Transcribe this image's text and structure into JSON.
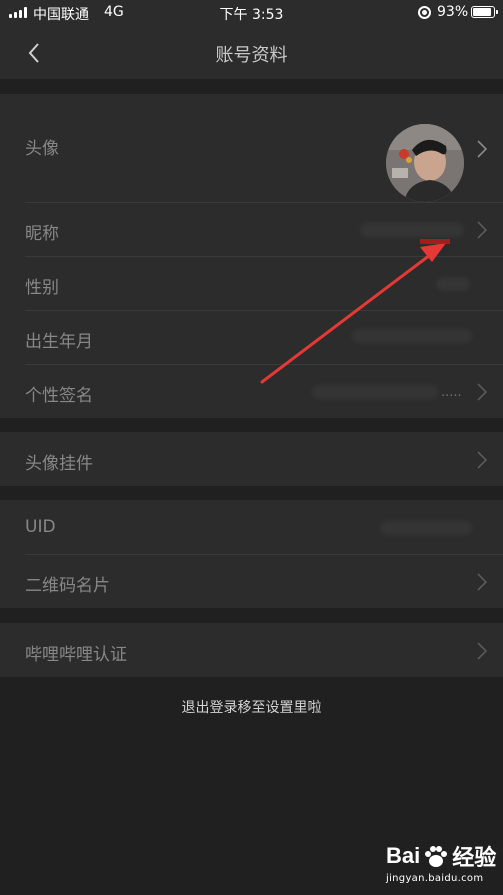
{
  "status_bar": {
    "carrier": "中国联通",
    "network": "4G",
    "time": "下午 3:53",
    "battery_percent": "93%",
    "battery_level": 0.93
  },
  "nav": {
    "title": "账号资料",
    "back_icon": "chevron-left-icon"
  },
  "profile_group": {
    "avatar_label": "头像",
    "nickname_label": "昵称",
    "gender_label": "性别",
    "birth_label": "出生年月",
    "signature_label": "个性签名",
    "signature_ellipsis": "....."
  },
  "pendant_group": {
    "pendant_label": "头像挂件"
  },
  "id_group": {
    "uid_label": "UID",
    "qrcode_label": "二维码名片"
  },
  "verify_group": {
    "verify_label": "哔哩哔哩认证"
  },
  "footer": {
    "logout_hint": "退出登录移至设置里啦"
  },
  "watermark": {
    "brand_left": "Bai",
    "brand_right": "经验",
    "url": "jingyan.baidu.com"
  },
  "colors": {
    "background": "#202020",
    "card": "#2c2c2c",
    "annotation_arrow": "#e53935"
  }
}
